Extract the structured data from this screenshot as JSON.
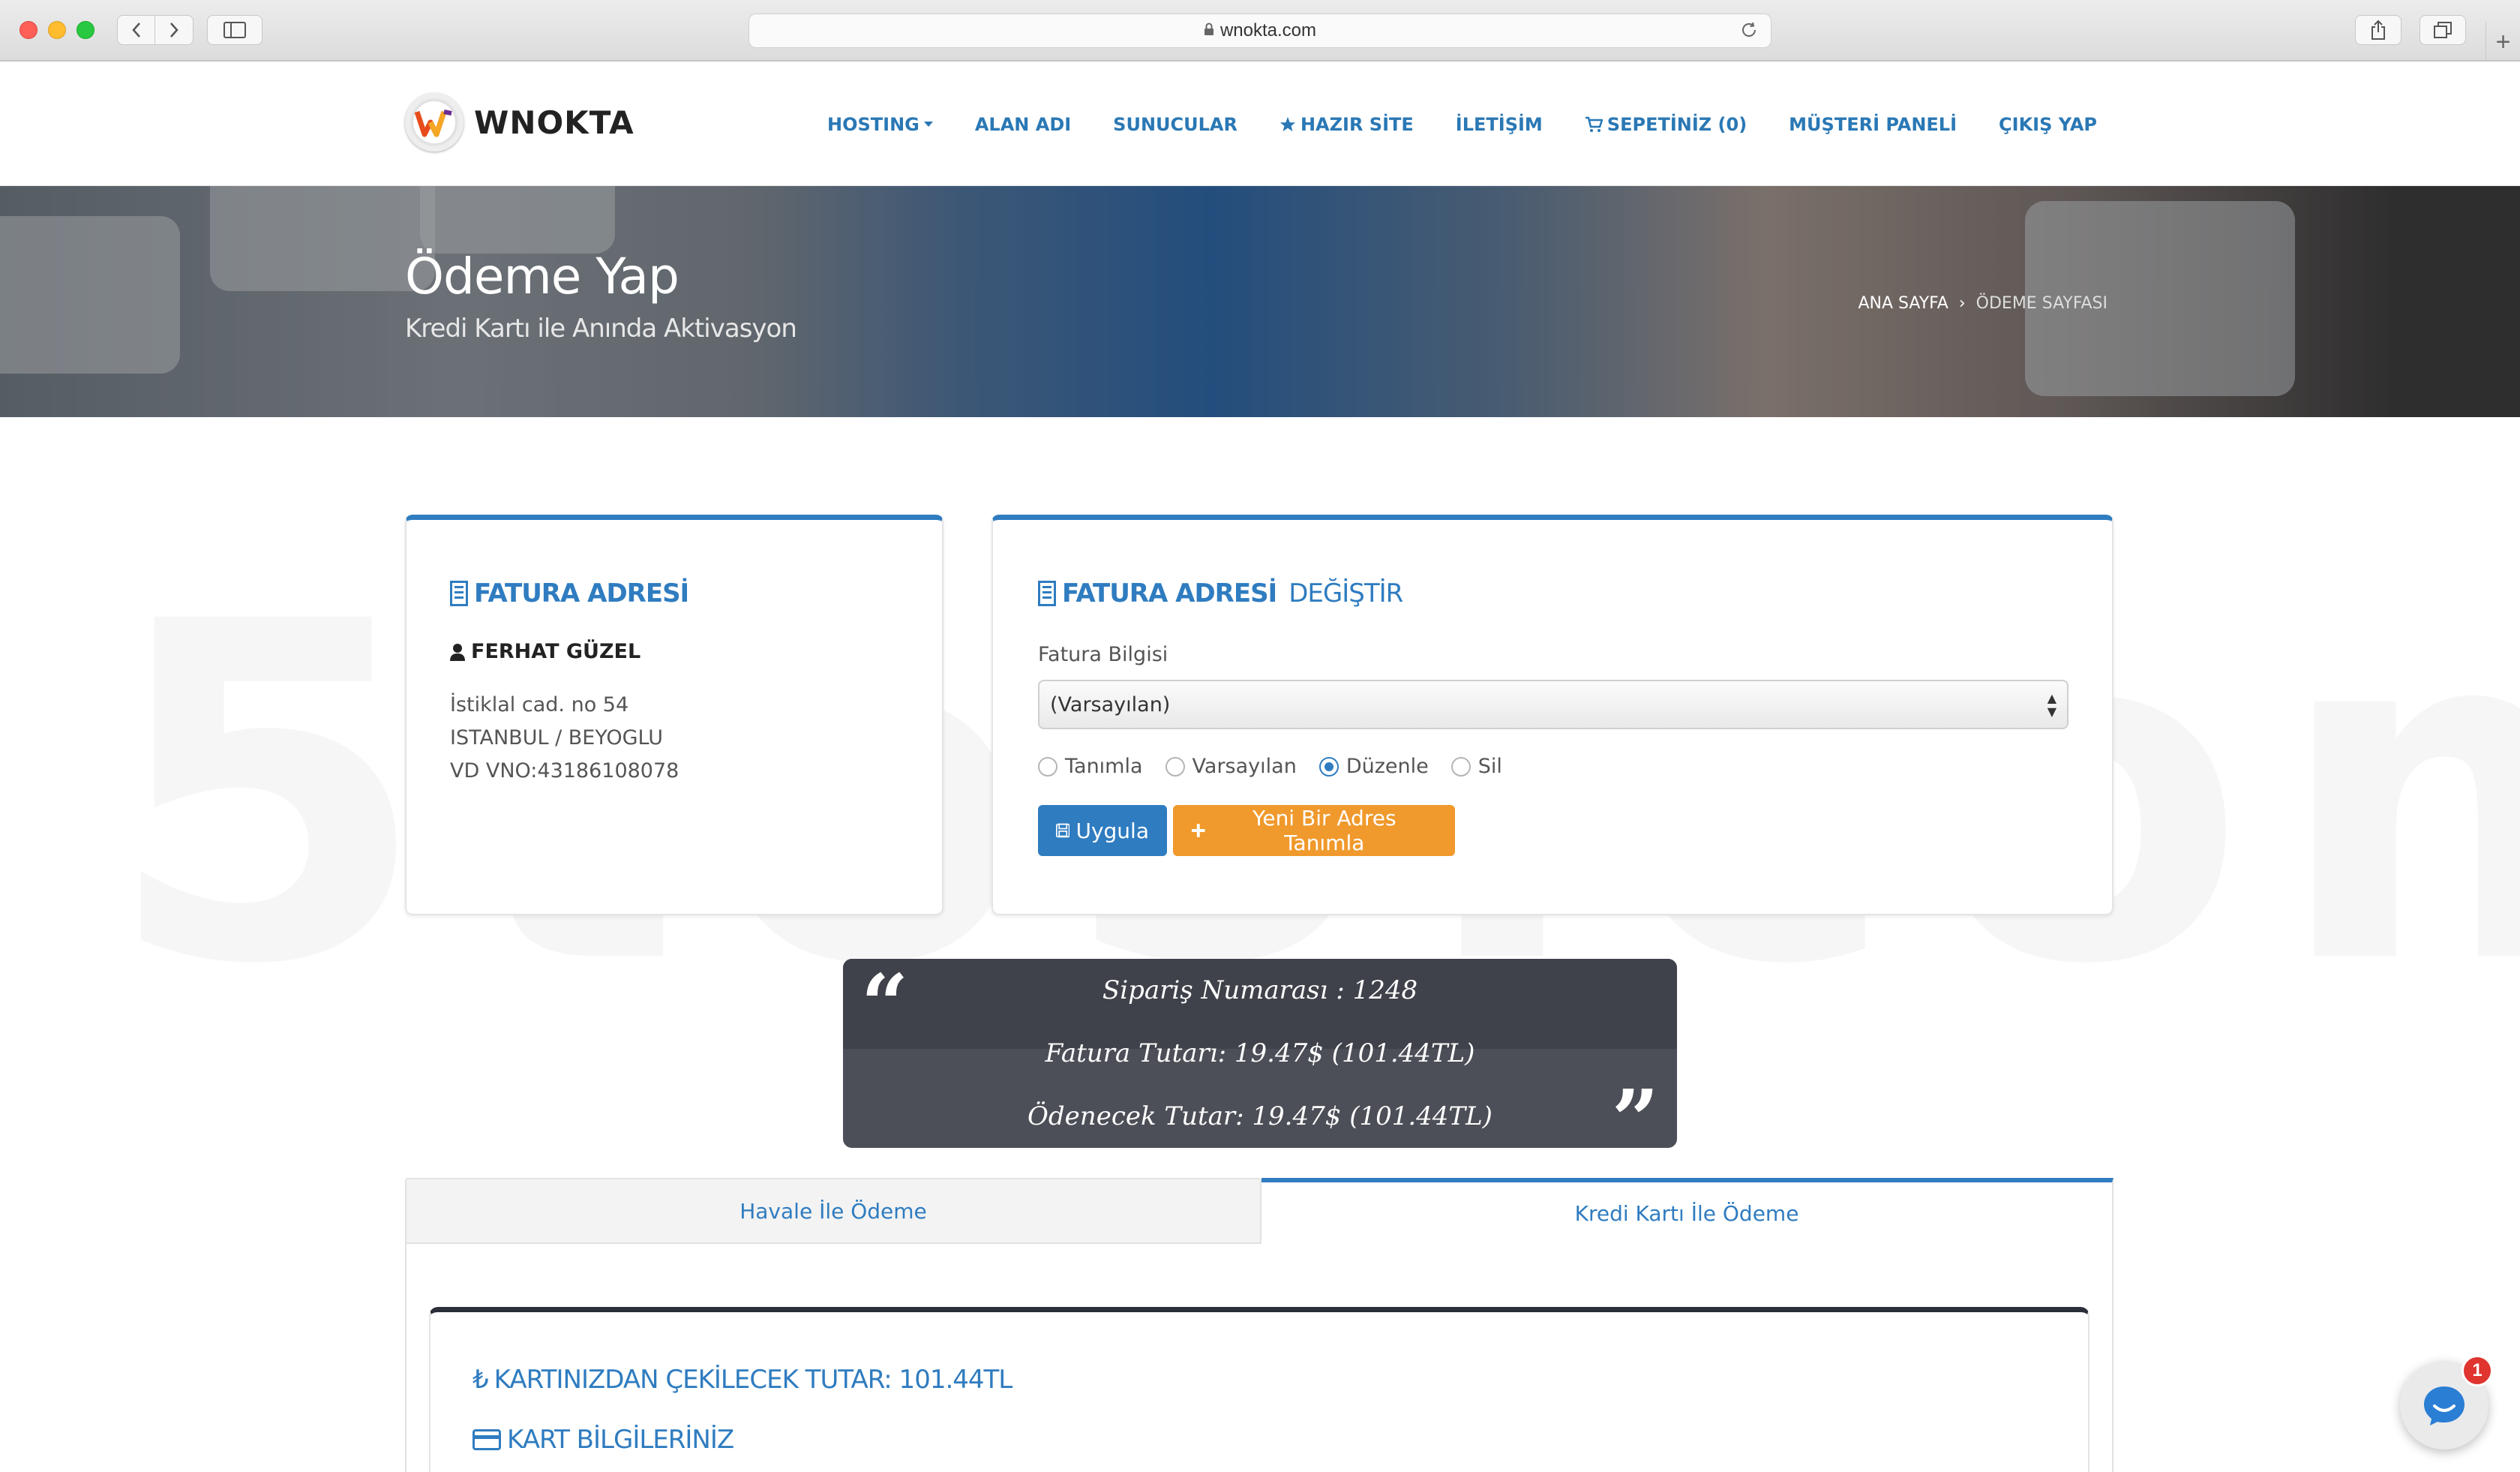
{
  "browser": {
    "url": "wnokta.com"
  },
  "header": {
    "logo_text": "WNOKTA",
    "nav": [
      {
        "label": "HOSTING"
      },
      {
        "label": "ALAN ADI"
      },
      {
        "label": "SUNUCULAR"
      },
      {
        "label": "HAZIR SİTE"
      },
      {
        "label": "İLETİŞİM"
      },
      {
        "label": "SEPETİNİZ (0)"
      },
      {
        "label": "MÜŞTERİ PANELİ"
      },
      {
        "label": "ÇIKIŞ YAP"
      }
    ]
  },
  "hero": {
    "title": "Ödeme Yap",
    "subtitle": "Kredi Kartı ile Anında Aktivasyon",
    "breadcrumb": [
      "ANA SAYFA",
      "ÖDEME SAYFASI"
    ]
  },
  "billing": {
    "title": "FATURA ADRESİ",
    "name": "FERHAT GÜZEL",
    "address": [
      "İstiklal cad. no 54",
      "ISTANBUL / BEYOGLU",
      "VD VNO:43186108078"
    ]
  },
  "change": {
    "title_bold": "FATURA ADRESİ",
    "title_light": "DEĞİŞTİR",
    "field_label": "Fatura Bilgisi",
    "selected": "(Varsayılan)",
    "radios": [
      {
        "label": "Tanımla",
        "checked": false
      },
      {
        "label": "Varsayılan",
        "checked": false
      },
      {
        "label": "Düzenle",
        "checked": true
      },
      {
        "label": "Sil",
        "checked": false
      }
    ],
    "apply_button": "Uygula",
    "new_button": "Yeni Bir Adres Tanımla"
  },
  "summary": {
    "order": "Sipariş Numarası : 1248",
    "invoice": "Fatura Tutarı: 19.47$ (101.44TL)",
    "payable": "Ödenecek Tutar: 19.47$ (101.44TL)"
  },
  "tabs": {
    "havale": "Havale İle Ödeme",
    "kredi": "Kredi Kartı İle Ödeme"
  },
  "payment": {
    "amount_label": "KARTINIZDAN ÇEKİLECEK TUTAR: 101.44TL",
    "card_info_label": "KART BİLGİLERİNİZ"
  },
  "chat": {
    "badge": "1"
  },
  "colors": {
    "accent": "#2f7cc0",
    "orange": "#f0992c",
    "summary_bg": "#4c4f57"
  }
}
